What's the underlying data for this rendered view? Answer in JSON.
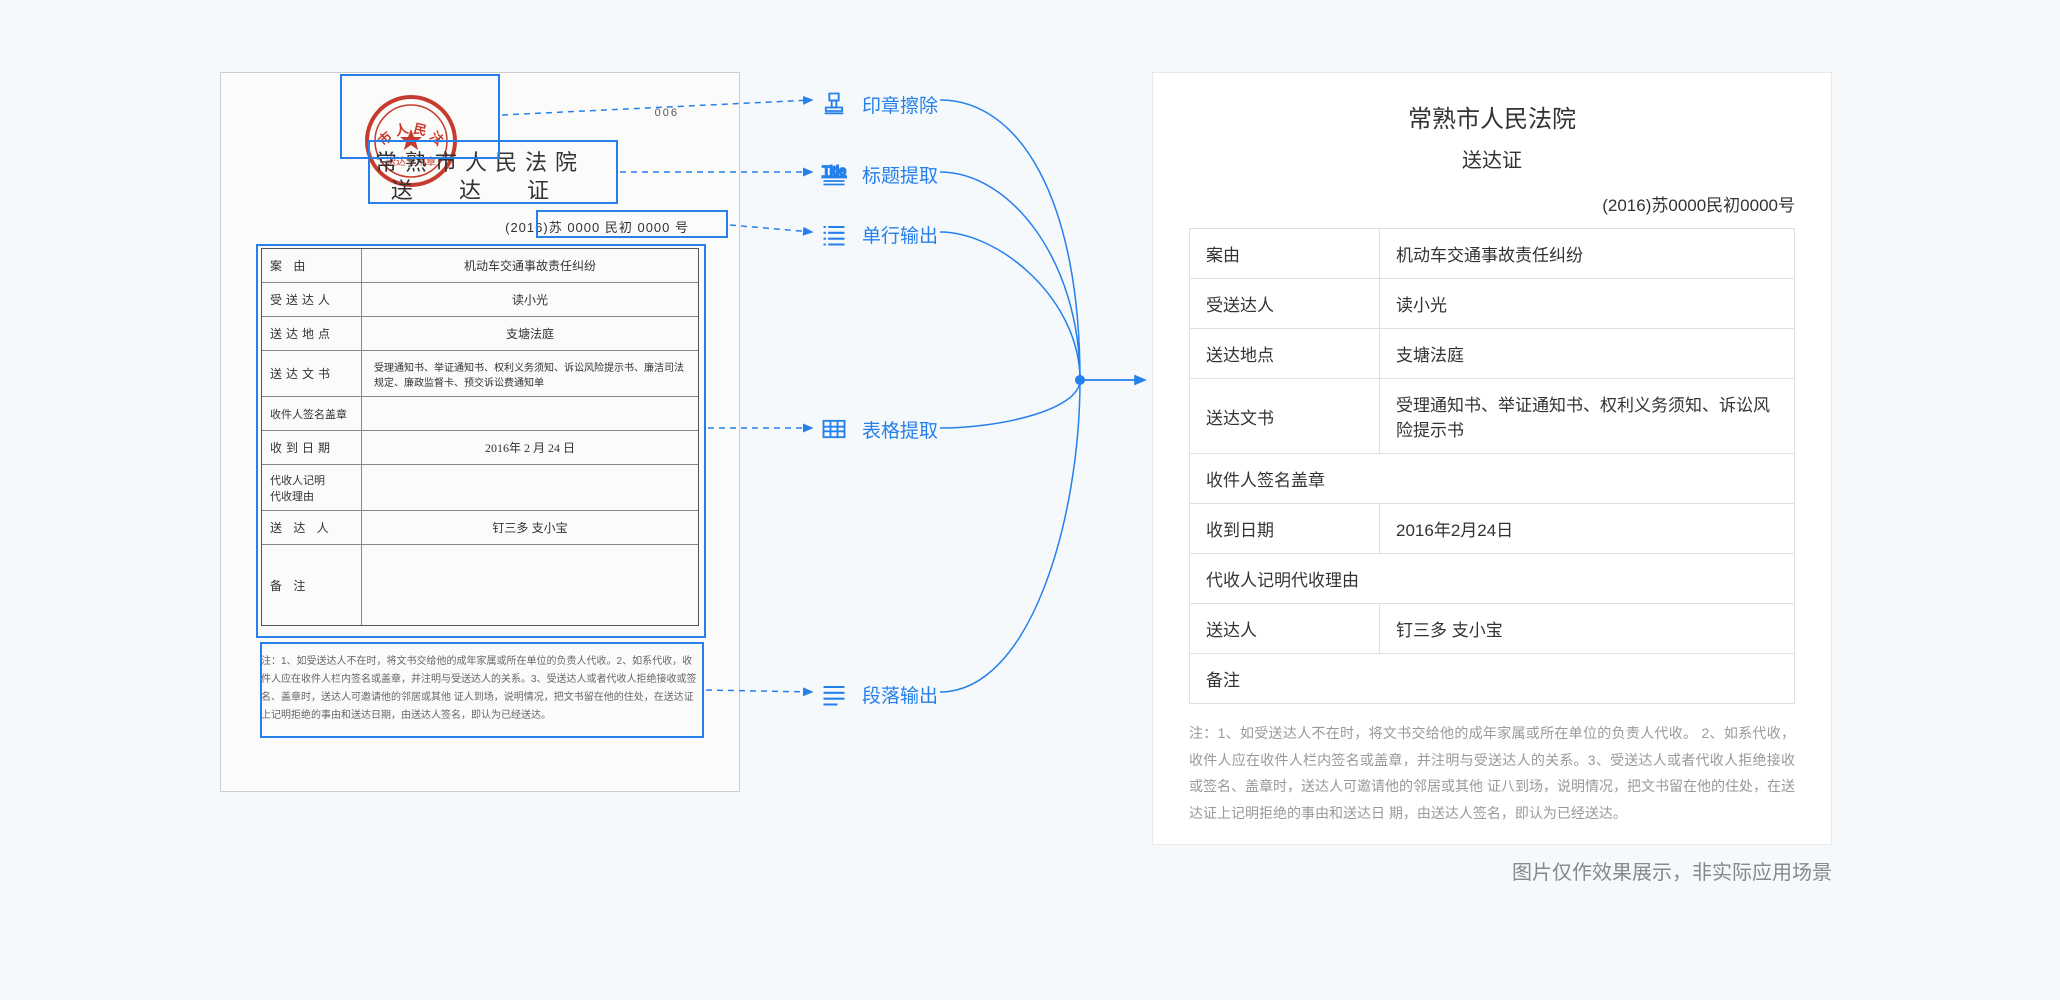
{
  "scanned": {
    "small_num": "006",
    "title": "常熟市人民法院",
    "subtitle": "送 达 证",
    "case_no": "(2016)苏 0000 民初  0000 号",
    "rows": [
      {
        "label": "案    由",
        "value": "机动车交通事故责任纠纷"
      },
      {
        "label": "受送达人",
        "value": "读小光"
      },
      {
        "label": "送达地点",
        "value": "支塘法庭"
      },
      {
        "label": "送达文书",
        "value": "受理通知书、举证通知书、权利义务须知、诉讼风险提示书、廉洁司法规定、廉政监督卡、预交诉讼费通知单"
      },
      {
        "label": "收件人签名盖章",
        "value": ""
      },
      {
        "label": "收到日期",
        "value": "2016年  2 月  24 日"
      },
      {
        "label": "代收人记明\n代收理由",
        "value": ""
      },
      {
        "label": "送 达 人",
        "value": "钉三多 支小宝"
      },
      {
        "label": "备    注",
        "value": ""
      }
    ],
    "notes": "注：1、如受送达人不在时，将文书交给他的成年家属或所在单位的负责人代收。2、如系代收，收件人应在收件人栏内签名或盖章，并注明与受送达人的关系。3、受送达人或者代收人拒绝接收或签名、盖章时，送达人可邀请他的邻居或其他 证人到场，说明情况，把文书留在他的住处，在送达证上记明拒绝的事由和送达日期，由送达人签名，即认为已经送达。"
  },
  "labels": {
    "stamp": "印章擦除",
    "title": "标题提取",
    "line": "单行输出",
    "table": "表格提取",
    "para": "段落输出"
  },
  "output": {
    "title": "常熟市人民法院",
    "subtitle": "送达证",
    "case_no": "(2016)苏0000民初0000号",
    "rows": [
      {
        "k": "案由",
        "v": "机动车交通事故责任纠纷"
      },
      {
        "k": "受送达人",
        "v": "读小光"
      },
      {
        "k": "送达地点",
        "v": "支塘法庭"
      },
      {
        "k": "送达文书",
        "v": "受理通知书、举证通知书、权利义务须知、诉讼风险提示书"
      },
      {
        "k": "收件人签名盖章",
        "v": ""
      },
      {
        "k": "收到日期",
        "v": "2016年2月24日"
      },
      {
        "k": "代收人记明代收理由",
        "v": ""
      },
      {
        "k": "送达人",
        "v": "钉三多 支小宝"
      },
      {
        "k": "备注",
        "v": ""
      }
    ],
    "notes": "注：1、如受送达人不在时，将文书交给他的成年家属或所在单位的负责人代收。 2、如系代收，收件人应在收件人栏内签名或盖章，并注明与受送达人的关系。3、受送达人或者代收人拒绝接收或签名、盖章时，送达人可邀请他的邻居或其他 证八到场，说明情况，把文书留在他的住处，在送达证上记明拒绝的事由和送达日 期，由送达人签名，即认为已经送达。"
  },
  "disclaimer": "图片仅作效果展示，非实际应用场景"
}
